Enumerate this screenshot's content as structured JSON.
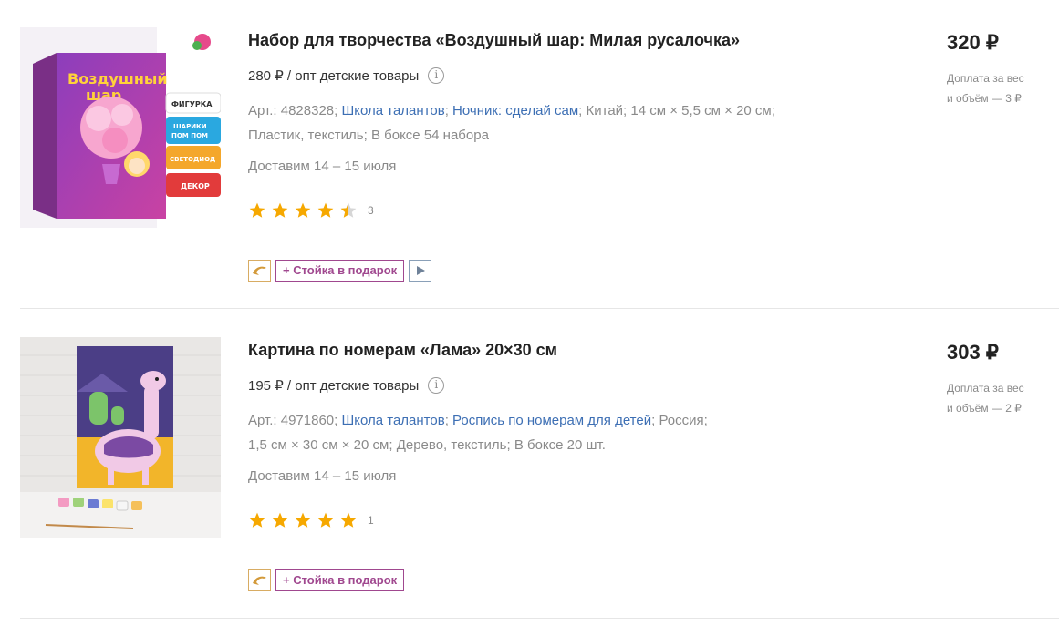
{
  "products": [
    {
      "title": "Набор для творчества «Воздушный шар: Милая русалочка»",
      "wholesale": "280 ₽ / опт детские товары",
      "article_prefix": "Арт.:",
      "article": "4828328",
      "brand": "Школа талантов",
      "series": "Ночник: сделай сам",
      "country": "Китай",
      "dimensions": "14 см × 5,5 см × 20 см",
      "material": "Пластик, текстиль",
      "box": "В боксе 54 набора",
      "delivery": "Доставим 14 – 15 июля",
      "rating": 4.5,
      "rating_count": "3",
      "gift_label": "+ Стойка в подарок",
      "has_video": true,
      "price": "320 ₽",
      "surcharge_line1": "Доплата за вес",
      "surcharge_line2": "и объём — 3 ₽",
      "image_icon": "craft-kit-box-image"
    },
    {
      "title": "Картина по номерам «Лама» 20×30 см",
      "wholesale": "195 ₽ / опт детские товары",
      "article_prefix": "Арт.:",
      "article": "4971860",
      "brand": "Школа талантов",
      "series": "Роспись по номерам для детей",
      "country": "Россия",
      "dimensions": "1,5 см × 30 см × 20 см",
      "material": "Дерево, текстиль",
      "box": "В боксе 20 шт.",
      "delivery": "Доставим 14 – 15 июля",
      "rating": 5,
      "rating_count": "1",
      "gift_label": "+ Стойка в подарок",
      "has_video": false,
      "price": "303 ₽",
      "surcharge_line1": "Доплата за вес",
      "surcharge_line2": "и объём — 2 ₽",
      "image_icon": "llama-painting-image"
    }
  ],
  "colors": {
    "link": "#3d6fb4",
    "star": "#f6a800",
    "star_empty": "#d6d6d6",
    "gift_badge": "#a0488f",
    "muted": "#8a8a8a"
  }
}
